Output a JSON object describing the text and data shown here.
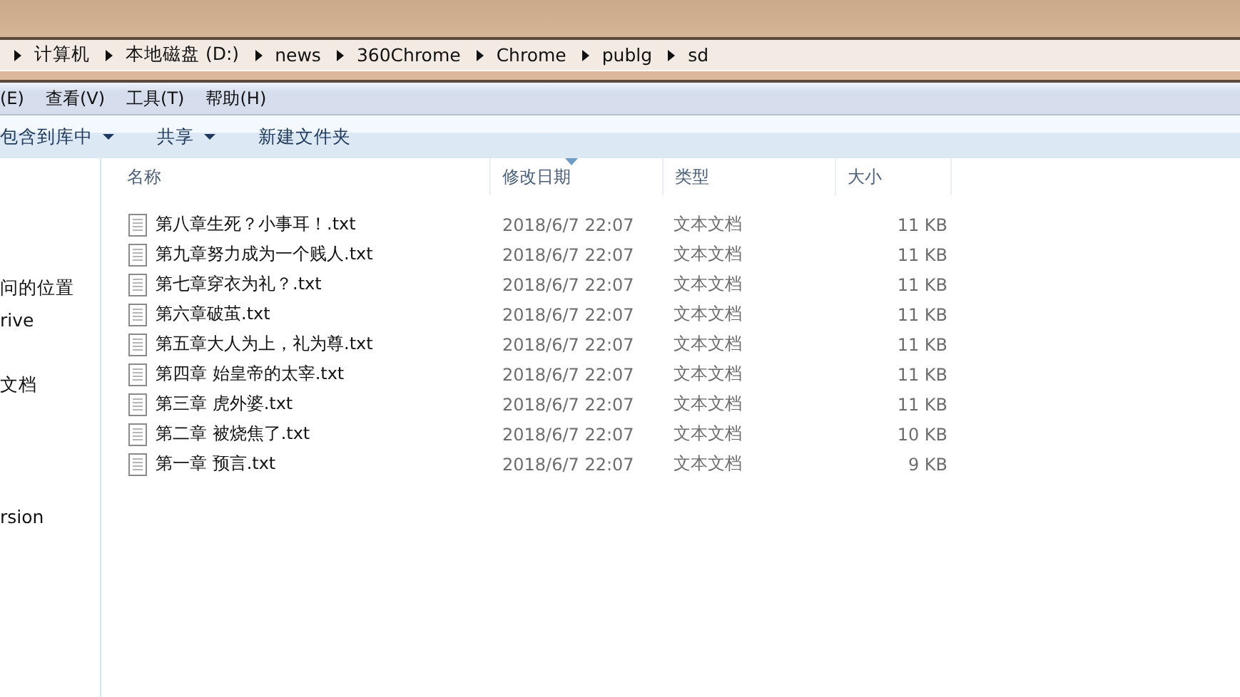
{
  "breadcrumb": [
    "计算机",
    "本地磁盘 (D:)",
    "news",
    "360Chrome",
    "Chrome",
    "publg",
    "sd"
  ],
  "menu": [
    "(E)",
    "查看(V)",
    "工具(T)",
    "帮助(H)"
  ],
  "toolbar": [
    {
      "label": "包含到库中",
      "dropdown": true
    },
    {
      "label": "共享",
      "dropdown": true
    },
    {
      "label": "新建文件夹",
      "dropdown": false
    }
  ],
  "sidebar": {
    "items": [
      {
        "label": "问的位置"
      },
      {
        "label": "rive"
      },
      {
        "label": "文档"
      },
      {
        "label": "rsion"
      }
    ]
  },
  "table": {
    "columns": [
      {
        "label": "名称",
        "sorted": false
      },
      {
        "label": "修改日期",
        "sorted": true
      },
      {
        "label": "类型",
        "sorted": false
      },
      {
        "label": "大小",
        "sorted": false
      }
    ],
    "rows": [
      {
        "name": "第八章生死？小事耳！.txt",
        "date": "2018/6/7 22:07",
        "type": "文本文档",
        "size": "11 KB"
      },
      {
        "name": "第九章努力成为一个贱人.txt",
        "date": "2018/6/7 22:07",
        "type": "文本文档",
        "size": "11 KB"
      },
      {
        "name": "第七章穿衣为礼？.txt",
        "date": "2018/6/7 22:07",
        "type": "文本文档",
        "size": "11 KB"
      },
      {
        "name": "第六章破茧.txt",
        "date": "2018/6/7 22:07",
        "type": "文本文档",
        "size": "11 KB"
      },
      {
        "name": "第五章大人为上，礼为尊.txt",
        "date": "2018/6/7 22:07",
        "type": "文本文档",
        "size": "11 KB"
      },
      {
        "name": "第四章 始皇帝的太宰.txt",
        "date": "2018/6/7 22:07",
        "type": "文本文档",
        "size": "11 KB"
      },
      {
        "name": "第三章 虎外婆.txt",
        "date": "2018/6/7 22:07",
        "type": "文本文档",
        "size": "11 KB"
      },
      {
        "name": "第二章 被烧焦了.txt",
        "date": "2018/6/7 22:07",
        "type": "文本文档",
        "size": "10 KB"
      },
      {
        "name": "第一章 预言.txt",
        "date": "2018/6/7 22:07",
        "type": "文本文档",
        "size": "9 KB"
      }
    ]
  }
}
